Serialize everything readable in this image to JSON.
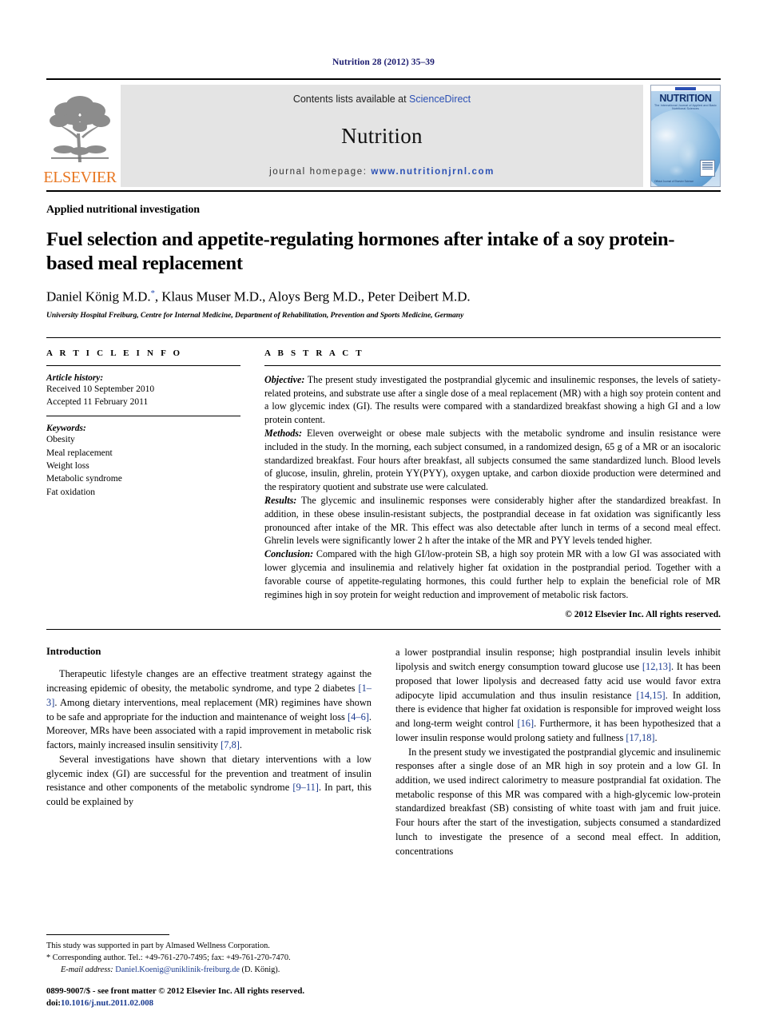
{
  "journal_ref": "Nutrition 28 (2012) 35–39",
  "masthead": {
    "elsevier_wordmark": "ELSEVIER",
    "contents_prefix": "Contents lists available at ",
    "contents_link": "ScienceDirect",
    "journal_name": "Nutrition",
    "homepage_prefix": "journal homepage: ",
    "homepage_url": "www.nutritionjrnl.com",
    "cover": {
      "title": "NUTRITION",
      "subtitle": "The International Journal of Applied and Basic Nutritional Sciences",
      "footer": "Official Journal of Elsevier Science"
    }
  },
  "article": {
    "section_label": "Applied nutritional investigation",
    "title": "Fuel selection and appetite-regulating hormones after intake of a soy protein-based meal replacement",
    "authors": "Daniel König M.D.",
    "authors_rest": ", Klaus Muser M.D., Aloys Berg M.D., Peter Deibert M.D.",
    "corresponding_marker": "*",
    "affiliation": "University Hospital Freiburg, Centre for Internal Medicine, Department of Rehabilitation, Prevention and Sports Medicine, Germany"
  },
  "article_info": {
    "heading": "A R T I C L E   I N F O",
    "history_label": "Article history:",
    "received": "Received 10 September 2010",
    "accepted": "Accepted 11 February 2011",
    "keywords_label": "Keywords:",
    "keywords": [
      "Obesity",
      "Meal replacement",
      "Weight loss",
      "Metabolic syndrome",
      "Fat oxidation"
    ]
  },
  "abstract": {
    "heading": "A B S T R A C T",
    "objective_label": "Objective:",
    "objective_text": " The present study investigated the postprandial glycemic and insulinemic responses, the levels of satiety-related proteins, and substrate use after a single dose of a meal replacement (MR) with a high soy protein content and a low glycemic index (GI). The results were compared with a standardized breakfast showing a high GI and a low protein content.",
    "methods_label": "Methods:",
    "methods_text": " Eleven overweight or obese male subjects with the metabolic syndrome and insulin resistance were included in the study. In the morning, each subject consumed, in a randomized design, 65 g of a MR or an isocaloric standardized breakfast. Four hours after breakfast, all subjects consumed the same standardized lunch. Blood levels of glucose, insulin, ghrelin, protein YY(PYY), oxygen uptake, and carbon dioxide production were determined and the respiratory quotient and substrate use were calculated.",
    "results_label": "Results:",
    "results_text": " The glycemic and insulinemic responses were considerably higher after the standardized breakfast. In addition, in these obese insulin-resistant subjects, the postprandial decease in fat oxidation was significantly less pronounced after intake of the MR. This effect was also detectable after lunch in terms of a second meal effect. Ghrelin levels were significantly lower 2 h after the intake of the MR and PYY levels tended higher.",
    "conclusion_label": "Conclusion:",
    "conclusion_text": " Compared with the high GI/low-protein SB, a high soy protein MR with a low GI was associated with lower glycemia and insulinemia and relatively higher fat oxidation in the postprandial period. Together with a favorable course of appetite-regulating hormones, this could further help to explain the beneficial role of MR regimines high in soy protein for weight reduction and improvement of metabolic risk factors.",
    "copyright": "© 2012 Elsevier Inc. All rights reserved."
  },
  "introduction": {
    "heading": "Introduction",
    "left_paragraphs": [
      {
        "parts": [
          {
            "t": "Therapeutic lifestyle changes are an effective treatment strategy against the increasing epidemic of obesity, the metabolic syndrome, and type 2 diabetes ",
            "ref": false
          },
          {
            "t": "[1–3]",
            "ref": true
          },
          {
            "t": ". Among dietary interventions, meal replacement (MR) regimines have shown to be safe and appropriate for the induction and maintenance of weight loss ",
            "ref": false
          },
          {
            "t": "[4–6]",
            "ref": true
          },
          {
            "t": ". Moreover, MRs have been associated with a rapid improvement in metabolic risk factors, mainly increased insulin sensitivity ",
            "ref": false
          },
          {
            "t": "[7,8]",
            "ref": true
          },
          {
            "t": ".",
            "ref": false
          }
        ]
      },
      {
        "parts": [
          {
            "t": "Several investigations have shown that dietary interventions with a low glycemic index (GI) are successful for the prevention and treatment of insulin resistance and other components of the metabolic syndrome ",
            "ref": false
          },
          {
            "t": "[9–11]",
            "ref": true
          },
          {
            "t": ". In part, this could be explained by",
            "ref": false
          }
        ]
      }
    ],
    "right_paragraphs": [
      {
        "indent": false,
        "parts": [
          {
            "t": "a lower postprandial insulin response; high postprandial insulin levels inhibit lipolysis and switch energy consumption toward glucose use ",
            "ref": false
          },
          {
            "t": "[12,13]",
            "ref": true
          },
          {
            "t": ". It has been proposed that lower lipolysis and decreased fatty acid use would favor extra adipocyte lipid accumulation and thus insulin resistance ",
            "ref": false
          },
          {
            "t": "[14,15]",
            "ref": true
          },
          {
            "t": ". In addition, there is evidence that higher fat oxidation is responsible for improved weight loss and long-term weight control ",
            "ref": false
          },
          {
            "t": "[16]",
            "ref": true
          },
          {
            "t": ". Furthermore, it has been hypothesized that a lower insulin response would prolong satiety and fullness ",
            "ref": false
          },
          {
            "t": "[17,18]",
            "ref": true
          },
          {
            "t": ".",
            "ref": false
          }
        ]
      },
      {
        "indent": true,
        "parts": [
          {
            "t": "In the present study we investigated the postprandial glycemic and insulinemic responses after a single dose of an MR high in soy protein and a low GI. In addition, we used indirect calorimetry to measure postprandial fat oxidation. The metabolic response of this MR was compared with a high-glycemic low-protein standardized breakfast (SB) consisting of white toast with jam and fruit juice. Four hours after the start of the investigation, subjects consumed a standardized lunch to investigate the presence of a second meal effect. In addition, concentrations",
            "ref": false
          }
        ]
      }
    ]
  },
  "footnotes": {
    "funding": "This study was supported in part by Almased Wellness Corporation.",
    "corresponding": "* Corresponding author. Tel.: +49-761-270-7495; fax: +49-761-270-7470.",
    "email_label": "E-mail address:",
    "email": "Daniel.Koenig@uniklinik-freiburg.de",
    "email_suffix": " (D. König).",
    "issn_line": "0899-9007/$ - see front matter © 2012 Elsevier Inc. All rights reserved.",
    "doi_label": "doi:",
    "doi": "10.1016/j.nut.2011.02.008"
  }
}
